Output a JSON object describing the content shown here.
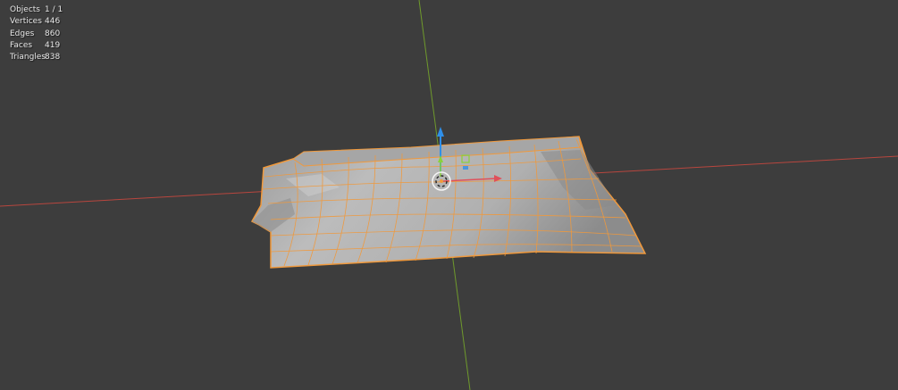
{
  "viewport": {
    "background": "#3d3d3d",
    "selection_color": "#f0993c",
    "axis_x_color": "#b8463e",
    "axis_y_color": "#6f9a2c",
    "gizmo_z_color": "#2f8fe8",
    "gizmo_x_color": "#e0505a",
    "gizmo_y_color": "#8ad23a"
  },
  "stats": {
    "objects_label": "Objects",
    "objects_value": "1 / 1",
    "vertices_label": "Vertices",
    "vertices_value": "446",
    "edges_label": "Edges",
    "edges_value": "860",
    "faces_label": "Faces",
    "faces_value": "419",
    "triangles_label": "Triangles",
    "triangles_value": "838"
  },
  "gizmo": {
    "origin_icon": "object-origin-icon",
    "z_arrow_icon": "arrow-up-icon",
    "x_arrow_icon": "arrow-right-icon",
    "y_arrow_icon": "arrow-up-icon"
  }
}
